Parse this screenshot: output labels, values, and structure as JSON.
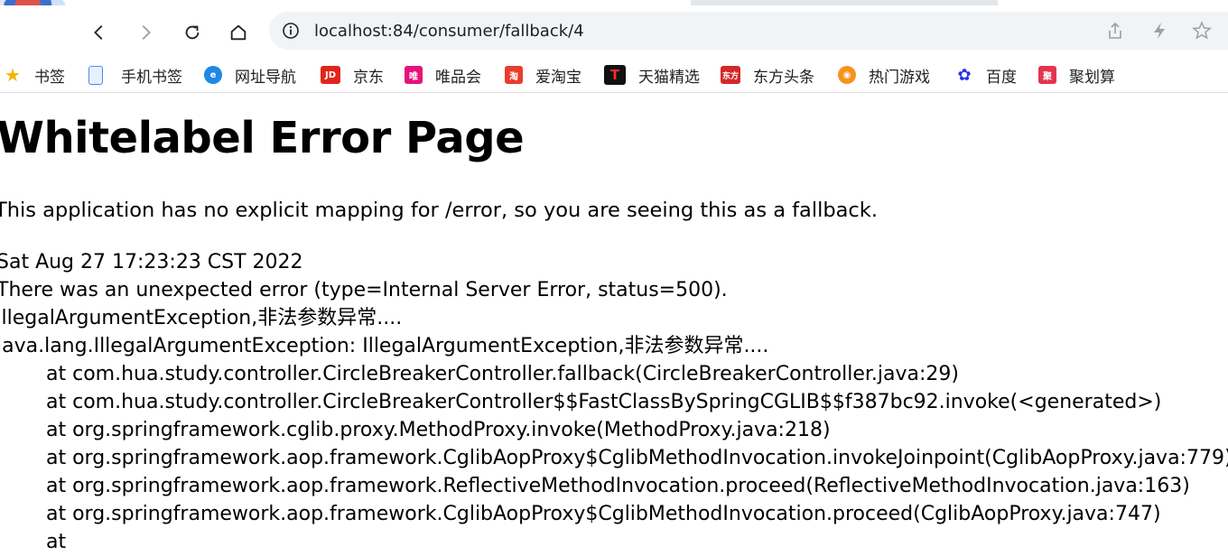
{
  "browser": {
    "url": "localhost:84/consumer/fallback/4",
    "bookmarks": [
      {
        "label": "书签",
        "icon": "star-icon",
        "color": "#f4b400"
      },
      {
        "label": "手机书签",
        "icon": "phone-bookmark-icon",
        "color": "#4a8af4"
      },
      {
        "label": "网址导航",
        "icon": "ie-icon",
        "color": "#1e88e5"
      },
      {
        "label": "京东",
        "icon": "jd-icon",
        "color": "#e1251b"
      },
      {
        "label": "唯品会",
        "icon": "vip-icon",
        "color": "#e6127c"
      },
      {
        "label": "爱淘宝",
        "icon": "taobao-icon",
        "color": "#ea3c2c"
      },
      {
        "label": "天猫精选",
        "icon": "tmall-icon",
        "color": "#111111"
      },
      {
        "label": "东方头条",
        "icon": "dftt-icon",
        "color": "#d52828"
      },
      {
        "label": "热门游戏",
        "icon": "game-icon",
        "color": "#f7931e"
      },
      {
        "label": "百度",
        "icon": "baidu-icon",
        "color": "#2932e1"
      },
      {
        "label": "聚划算",
        "icon": "juhuasuan-icon",
        "color": "#e5344f"
      }
    ]
  },
  "page": {
    "title": "Whitelabel Error Page",
    "description": "This application has no explicit mapping for /error, so you are seeing this as a fallback.",
    "timestamp": "Sat Aug 27 17:23:23 CST 2022",
    "status_line": "There was an unexpected error (type=Internal Server Error, status=500).",
    "message": "IllegalArgumentException,非法参数异常....",
    "exception": "java.lang.IllegalArgumentException: IllegalArgumentException,非法参数异常....",
    "stack": [
      "at com.hua.study.controller.CircleBreakerController.fallback(CircleBreakerController.java:29)",
      "at com.hua.study.controller.CircleBreakerController$$FastClassBySpringCGLIB$$f387bc92.invoke(<generated>)",
      "at org.springframework.cglib.proxy.MethodProxy.invoke(MethodProxy.java:218)",
      "at org.springframework.aop.framework.CglibAopProxy$CglibMethodInvocation.invokeJoinpoint(CglibAopProxy.java:779)",
      "at org.springframework.aop.framework.ReflectiveMethodInvocation.proceed(ReflectiveMethodInvocation.java:163)",
      "at org.springframework.aop.framework.CglibAopProxy$CglibMethodInvocation.proceed(CglibAopProxy.java:747)",
      "at"
    ]
  }
}
